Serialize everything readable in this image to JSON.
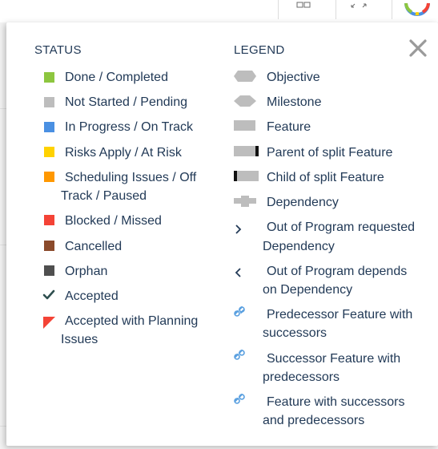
{
  "status": {
    "title": "STATUS",
    "items": [
      {
        "label": "Done / Completed",
        "color": "#8dc63f"
      },
      {
        "label": "Not Started / Pending",
        "color": "#bdbdbd"
      },
      {
        "label": "In Progress / On Track",
        "color": "#4a90e2"
      },
      {
        "label": "Risks Apply / At Risk",
        "color": "#ffd200"
      },
      {
        "label_line1": "Scheduling Issues / Off",
        "label_line2": "Track / Paused",
        "color": "#ff9800"
      },
      {
        "label": "Blocked / Missed",
        "color": "#f44336"
      },
      {
        "label": "Cancelled",
        "color": "#8b4a2b"
      },
      {
        "label": "Orphan",
        "color": "#4f4f4f"
      },
      {
        "label": "Accepted",
        "icon": "checkmark-icon",
        "color": "#2f4f4f"
      },
      {
        "label_line1": "Accepted with Planning",
        "label_line2": "Issues",
        "icon": "red-corner-flag-icon",
        "color": "#f44336"
      }
    ]
  },
  "legend": {
    "title": "LEGEND",
    "items": [
      {
        "label": "Objective",
        "icon": "hexagon-icon"
      },
      {
        "label": "Milestone",
        "icon": "diamond-bar-icon"
      },
      {
        "label": "Feature",
        "icon": "feature-bar-icon"
      },
      {
        "label": "Parent of split Feature",
        "icon": "parent-split-icon"
      },
      {
        "label": "Child of split Feature",
        "icon": "child-split-icon"
      },
      {
        "label": "Dependency",
        "icon": "dependency-icon"
      },
      {
        "label_line1": "Out of Program requested",
        "label_line2": "Dependency",
        "icon": "chevron-right-icon"
      },
      {
        "label_line1": "Out of Program depends",
        "label_line2": "on Dependency",
        "icon": "chevron-left-icon"
      },
      {
        "label_line1": "Predecessor Feature with",
        "label_line2": "successors",
        "icon": "link-icon"
      },
      {
        "label_line1": "Successor Feature with",
        "label_line2": "predecessors",
        "icon": "link-icon"
      },
      {
        "label_line1": "Feature with successors",
        "label_line2": "and predecessors",
        "icon": "link-icon"
      }
    ]
  },
  "colors": {
    "text": "#223a57",
    "icon_gray": "#bdbdbd",
    "link_blue": "#5aa0e0",
    "close_gray": "#9a9a9a"
  }
}
